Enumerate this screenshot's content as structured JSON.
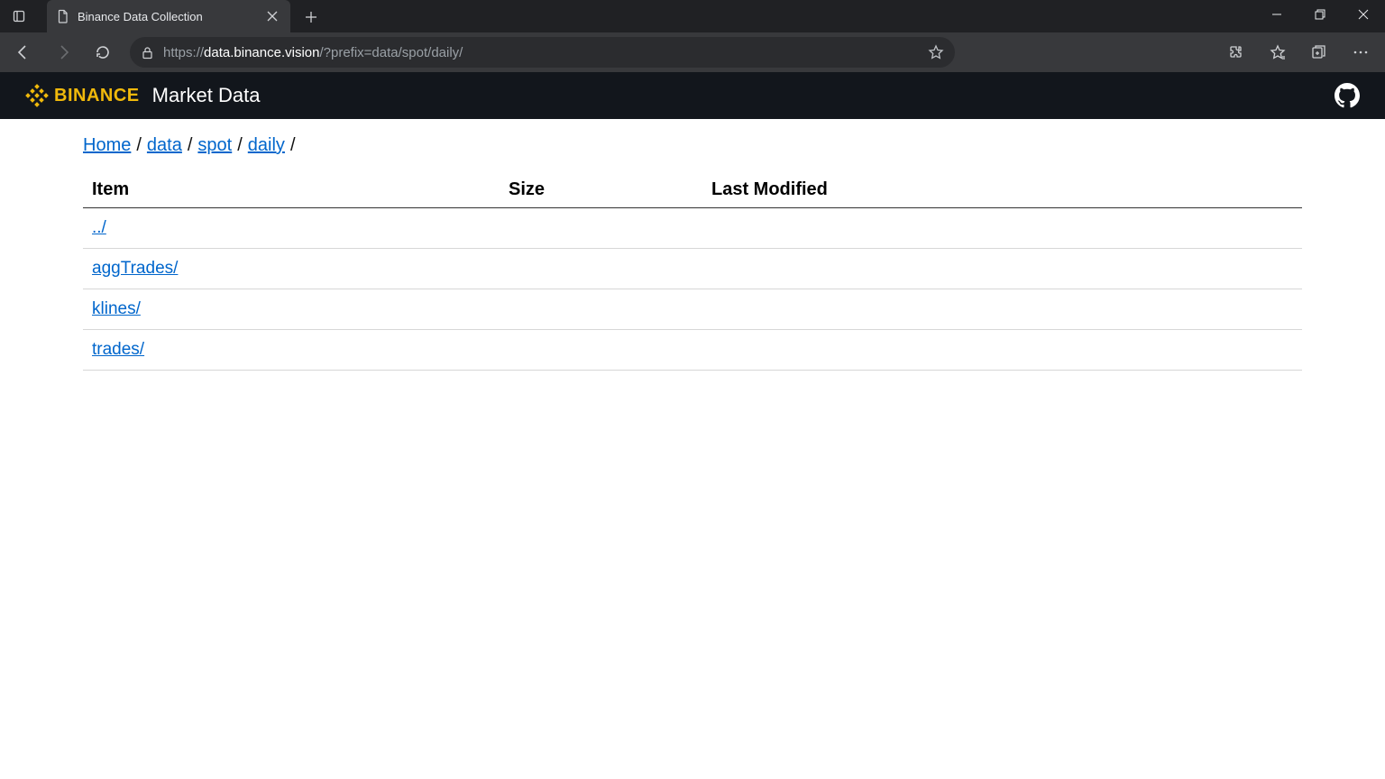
{
  "browser": {
    "tab_title": "Binance Data Collection",
    "url_proto": "https",
    "url_host": "data.binance.vision",
    "url_path": "/?prefix=data/spot/daily/"
  },
  "header": {
    "brand_text": "BINANCE",
    "sub_text": "Market Data"
  },
  "breadcrumb": {
    "items": [
      {
        "label": "Home"
      },
      {
        "label": "data"
      },
      {
        "label": "spot"
      },
      {
        "label": "daily"
      }
    ]
  },
  "table": {
    "columns": {
      "item": "Item",
      "size": "Size",
      "modified": "Last Modified"
    },
    "rows": [
      {
        "item": "../",
        "size": "",
        "modified": ""
      },
      {
        "item": "aggTrades/",
        "size": "",
        "modified": ""
      },
      {
        "item": "klines/",
        "size": "",
        "modified": ""
      },
      {
        "item": "trades/",
        "size": "",
        "modified": ""
      }
    ]
  }
}
